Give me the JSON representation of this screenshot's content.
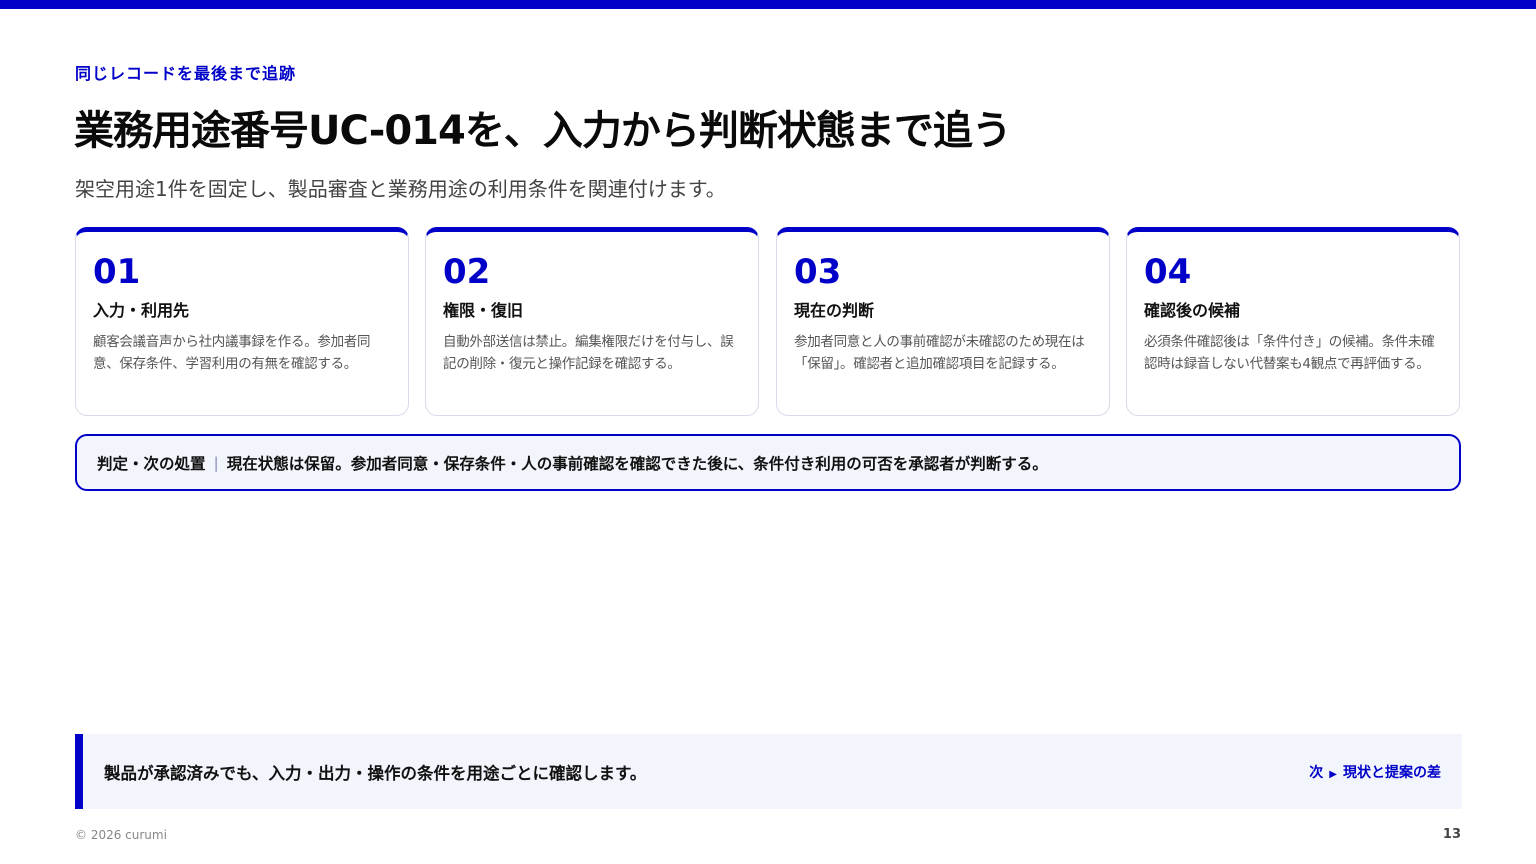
{
  "eyebrow": "同じレコードを最後まで追跡",
  "title": "業務用途番号UC-014を、入力から判断状態まで追う",
  "subtitle": "架空用途1件を固定し、製品審査と業務用途の利用条件を関連付けます。",
  "cards": [
    {
      "num": "01",
      "heading": "入力・利用先",
      "body": "顧客会議音声から社内議事録を作る。参加者同意、保存条件、学習利用の有無を確認する。"
    },
    {
      "num": "02",
      "heading": "権限・復旧",
      "body": "自動外部送信は禁止。編集権限だけを付与し、誤記の削除・復元と操作記録を確認する。"
    },
    {
      "num": "03",
      "heading": "現在の判断",
      "body": "参加者同意と人の事前確認が未確認のため現在は「保留」。確認者と追加確認項目を記録する。"
    },
    {
      "num": "04",
      "heading": "確認後の候補",
      "body": "必須条件確認後は「条件付き」の候補。条件未確認時は録音しない代替案も4観点で再評価する。"
    }
  ],
  "judgement": {
    "label": "判定・次の処置",
    "text": "現在状態は保留。参加者同意・保存条件・人の事前確認を確認できた後に、条件付き利用の可否を承認者が判断する。"
  },
  "footer": {
    "message": "製品が承認済みでも、入力・出力・操作の条件を用途ごとに確認します。",
    "next_prefix": "次",
    "next_label": "現状と提案の差"
  },
  "copyright": "© 2026 curumi",
  "page_number": "13",
  "colors": {
    "accent": "#0000c8",
    "panel_bg": "#f3f5fd"
  }
}
